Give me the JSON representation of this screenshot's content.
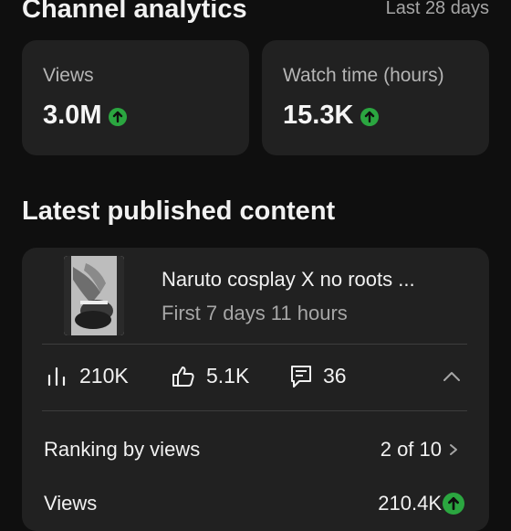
{
  "header": {
    "title": "Channel analytics",
    "range": "Last 28 days"
  },
  "stats": [
    {
      "label": "Views",
      "value": "3.0M",
      "trend": "up"
    },
    {
      "label": "Watch time (hours)",
      "value": "15.3K",
      "trend": "up"
    }
  ],
  "latest": {
    "section_title": "Latest published content",
    "video": {
      "title": "Naruto cosplay X no roots ...",
      "subtitle": "First 7 days 11 hours"
    },
    "metrics": {
      "views": "210K",
      "likes": "5.1K",
      "comments": "36"
    },
    "rows": [
      {
        "label": "Ranking by views",
        "value": "2 of 10"
      },
      {
        "label": "Views",
        "value": "210.4K"
      }
    ]
  },
  "colors": {
    "background": "#0f0f0f",
    "card": "#212121",
    "accent_up": "#2ba640"
  },
  "icons": [
    "arrow-up-icon",
    "bar-chart-icon",
    "thumbs-up-icon",
    "comment-icon",
    "chevron-up-icon",
    "chevron-right-icon"
  ]
}
